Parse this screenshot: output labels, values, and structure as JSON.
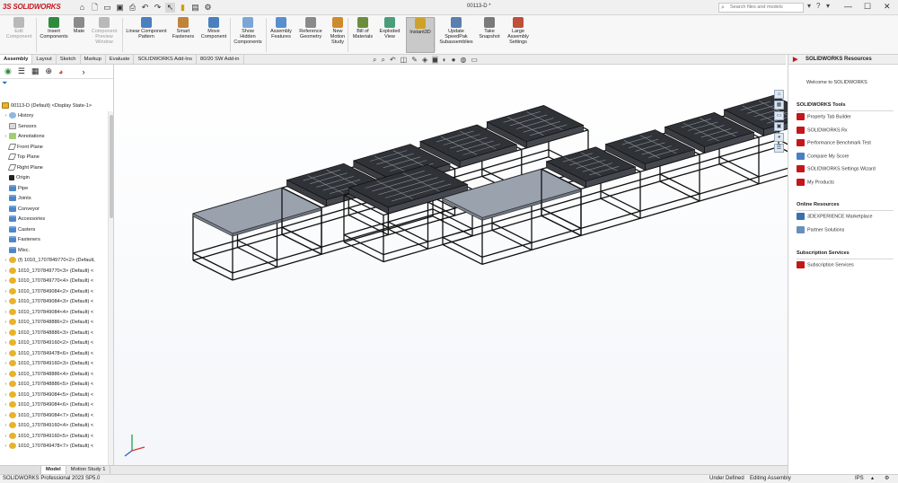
{
  "app": {
    "logo_ds": "3S",
    "logo_text": "SOLIDWORKS",
    "document_title": "00113-D *"
  },
  "search": {
    "placeholder": "Search files and models"
  },
  "title_icons": {
    "help": "?",
    "minimize": "—",
    "maximize": "☐",
    "close": "✕"
  },
  "ribbon": [
    {
      "label": "Edit\nComponent",
      "disabled": true,
      "color": "#b9b9b9"
    },
    {
      "label": "Insert\nComponents",
      "disabled": false,
      "color": "#2e8b3d"
    },
    {
      "label": "Mate",
      "disabled": false,
      "color": "#8b8b8b"
    },
    {
      "label": "Component\nPreview\nWindow",
      "disabled": true,
      "color": "#b9b9b9"
    },
    {
      "label": "Linear Component\nPattern",
      "disabled": false,
      "color": "#4a7fc0"
    },
    {
      "label": "Smart\nFasteners",
      "disabled": false,
      "color": "#c0843a"
    },
    {
      "label": "Move\nComponent",
      "disabled": false,
      "color": "#4a7fc0"
    },
    {
      "label": "Show\nHidden\nComponents",
      "disabled": false,
      "color": "#7aa7d8"
    },
    {
      "label": "Assembly\nFeatures",
      "disabled": false,
      "color": "#5a8fce"
    },
    {
      "label": "Reference\nGeometry",
      "disabled": false,
      "color": "#8a8a8a"
    },
    {
      "label": "New\nMotion\nStudy",
      "disabled": false,
      "color": "#cf8a2e"
    },
    {
      "label": "Bill of\nMaterials",
      "disabled": false,
      "color": "#6b8e3d"
    },
    {
      "label": "Exploded\nView",
      "disabled": false,
      "color": "#4a9e7a"
    },
    {
      "label": "Instant3D",
      "disabled": false,
      "active": true,
      "color": "#d0a12a"
    },
    {
      "label": "Update\nSpeedPak\nSubassemblies",
      "disabled": false,
      "color": "#5a7fb0"
    },
    {
      "label": "Take\nSnapshot",
      "disabled": false,
      "color": "#7a7a7a"
    },
    {
      "label": "Large\nAssembly\nSettings",
      "disabled": false,
      "color": "#c04f3a"
    }
  ],
  "tabs": [
    "Assembly",
    "Layout",
    "Sketch",
    "Markup",
    "Evaluate",
    "SOLIDWORKS Add-Ins",
    "80/20 SW Add-in"
  ],
  "feature_tree": {
    "root": "00113-D (Default) <Display State-1>",
    "items": [
      {
        "label": "History",
        "icon": "hist",
        "expand": true
      },
      {
        "label": "Sensors",
        "icon": "sens",
        "expand": false
      },
      {
        "label": "Annotations",
        "icon": "ann",
        "expand": true
      },
      {
        "label": "Front Plane",
        "icon": "plane",
        "expand": false
      },
      {
        "label": "Top Plane",
        "icon": "plane",
        "expand": false
      },
      {
        "label": "Right Plane",
        "icon": "plane",
        "expand": false
      },
      {
        "label": "Origin",
        "icon": "orig",
        "expand": false
      },
      {
        "label": "Pipe",
        "icon": "fold",
        "expand": false
      },
      {
        "label": "Joints",
        "icon": "fold",
        "expand": false
      },
      {
        "label": "Conveyor",
        "icon": "fold",
        "expand": false
      },
      {
        "label": "Accessories",
        "icon": "fold",
        "expand": false
      },
      {
        "label": "Casters",
        "icon": "fold",
        "expand": false
      },
      {
        "label": "Fasteners",
        "icon": "fold",
        "expand": false
      },
      {
        "label": "Misc.",
        "icon": "fold",
        "expand": false
      },
      {
        "label": "(f) 1010_1707849770<2> (Default,",
        "icon": "part",
        "expand": true
      },
      {
        "label": "1010_1707849770<3> (Default) <",
        "icon": "part",
        "expand": true
      },
      {
        "label": "1010_1707849770<4> (Default) <",
        "icon": "part",
        "expand": true
      },
      {
        "label": "1010_1707849084<2> (Default) <",
        "icon": "part",
        "expand": true
      },
      {
        "label": "1010_1707849084<3> (Default) <",
        "icon": "part",
        "expand": true
      },
      {
        "label": "1010_1707849084<4> (Default) <",
        "icon": "part",
        "expand": true
      },
      {
        "label": "1010_1707848886<2> (Default) <",
        "icon": "part",
        "expand": true
      },
      {
        "label": "1010_1707848886<3> (Default) <",
        "icon": "part",
        "expand": true
      },
      {
        "label": "1010_1707849160<2> (Default) <",
        "icon": "part",
        "expand": true
      },
      {
        "label": "1010_1707849478<6> (Default) <",
        "icon": "part",
        "expand": true
      },
      {
        "label": "1010_1707849160<3> (Default) <",
        "icon": "part",
        "expand": true
      },
      {
        "label": "1010_1707848886<4> (Default) <",
        "icon": "part",
        "expand": true
      },
      {
        "label": "1010_1707848886<5> (Default) <",
        "icon": "part",
        "expand": true
      },
      {
        "label": "1010_1707849084<5> (Default) <",
        "icon": "part",
        "expand": true
      },
      {
        "label": "1010_1707849084<6> (Default) <",
        "icon": "part",
        "expand": true
      },
      {
        "label": "1010_1707849084<7> (Default) <",
        "icon": "part",
        "expand": true
      },
      {
        "label": "1010_1707849160<4> (Default) <",
        "icon": "part",
        "expand": true
      },
      {
        "label": "1010_1707849160<5> (Default) <",
        "icon": "part",
        "expand": true
      },
      {
        "label": "1010_1707849478<7> (Default) <",
        "icon": "part",
        "expand": true
      }
    ]
  },
  "bottom_tabs": [
    "Model",
    "Motion Study 1"
  ],
  "status": {
    "left": "SOLIDWORKS Professional 2023 SP5.0",
    "under": "Under Defined",
    "editing": "Editing Assembly",
    "units": "IPS"
  },
  "resources": {
    "title": "SOLIDWORKS Resources",
    "welcome": "Welcome to SOLIDWORKS",
    "tools_title": "SOLIDWORKS Tools",
    "tools": [
      {
        "label": "Property Tab Builder",
        "color": "#c4161c"
      },
      {
        "label": "SOLIDWORKS Rx",
        "color": "#c4161c"
      },
      {
        "label": "Performance Benchmark Test",
        "color": "#c4161c"
      },
      {
        "label": "Compare My Score",
        "color": "#4a7fc0"
      },
      {
        "label": "SOLIDWORKS Settings Wizard",
        "color": "#c4161c"
      },
      {
        "label": "My Products",
        "color": "#c4161c"
      }
    ],
    "online_title": "Online Resources",
    "online": [
      {
        "label": "3DEXPERIENCE Marketplace",
        "color": "#3a6fb0"
      },
      {
        "label": "Partner Solutions",
        "color": "#6a8fb8"
      }
    ],
    "sub_title": "Subscription Services",
    "sub": [
      {
        "label": "Subscription Services",
        "color": "#c4161c"
      }
    ]
  }
}
